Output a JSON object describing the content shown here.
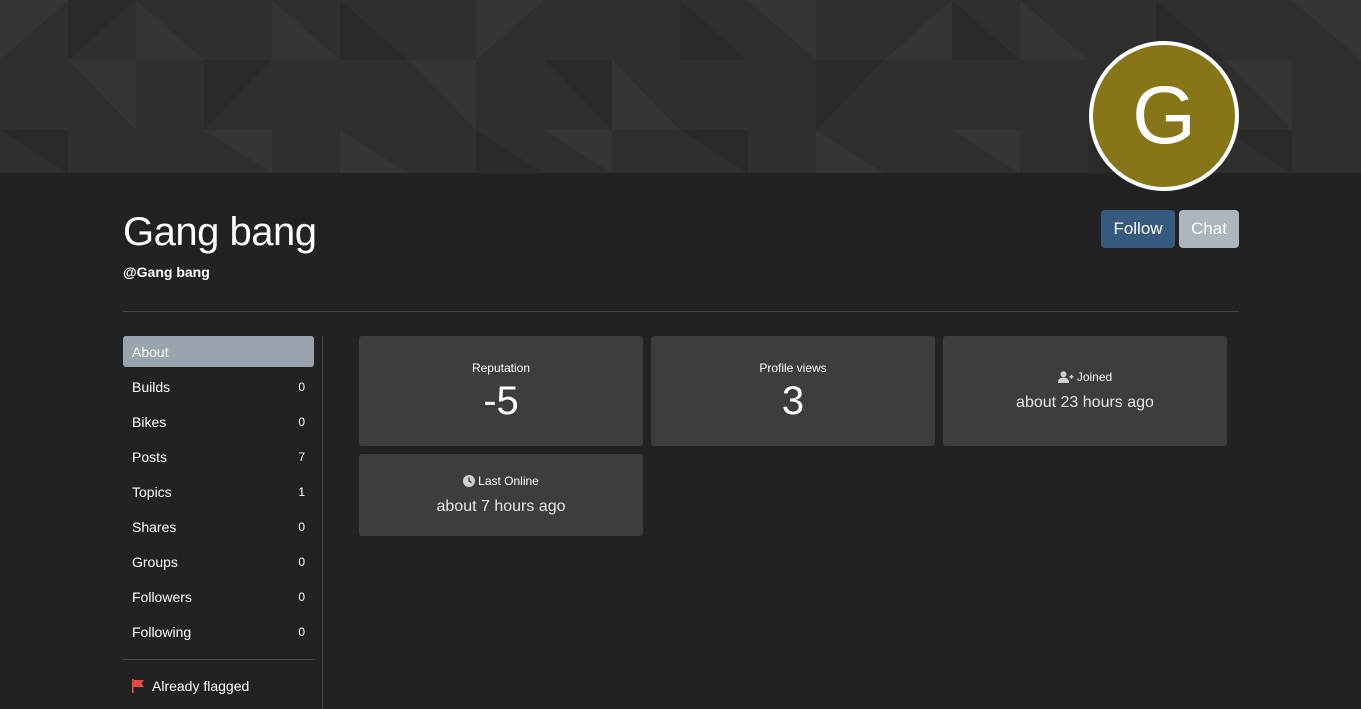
{
  "profile": {
    "avatar_letter": "G",
    "avatar_color": "#867617",
    "fullname": "Gang bang",
    "username": "@Gang bang"
  },
  "actions": {
    "follow_label": "Follow",
    "chat_label": "Chat"
  },
  "sidebar": {
    "items": [
      {
        "label": "About",
        "count": ""
      },
      {
        "label": "Builds",
        "count": "0"
      },
      {
        "label": "Bikes",
        "count": "0"
      },
      {
        "label": "Posts",
        "count": "7"
      },
      {
        "label": "Topics",
        "count": "1"
      },
      {
        "label": "Shares",
        "count": "0"
      },
      {
        "label": "Groups",
        "count": "0"
      },
      {
        "label": "Followers",
        "count": "0"
      },
      {
        "label": "Following",
        "count": "0"
      }
    ],
    "flag_label": "Already flagged"
  },
  "stats": {
    "reputation_label": "Reputation",
    "reputation_value": "-5",
    "views_label": "Profile views",
    "views_value": "3",
    "joined_label": "Joined",
    "joined_value": "about 23 hours ago",
    "online_label": "Last Online",
    "online_value": "about 7 hours ago"
  },
  "icons": {
    "joined": "user-plus-icon",
    "online": "clock-icon",
    "flag": "flag-icon"
  },
  "colors": {
    "follow": "#375a7f",
    "chat": "#adb5bd",
    "active_nav": "#9ba3af",
    "flag": "#e74c3c"
  }
}
